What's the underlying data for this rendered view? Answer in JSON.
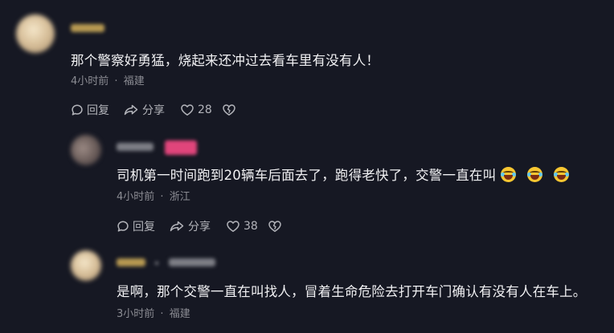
{
  "comments": [
    {
      "text": "那个警察好勇猛，烧起来还冲过去看车里有没有人！",
      "time": "4小时前",
      "dot": "·",
      "location": "福建",
      "reply_label": "回复",
      "share_label": "分享",
      "like_count": "28"
    },
    {
      "text": "司机第一时间跑到20辆车后面去了，跑得老快了，交警一直在叫",
      "time": "4小时前",
      "dot": "·",
      "location": "浙江",
      "reply_label": "回复",
      "share_label": "分享",
      "like_count": "38"
    },
    {
      "text": "是啊，那个交警一直在叫找人，冒着生命危险去打开车门确认有没有人在车上。",
      "time": "3小时前",
      "dot": "·",
      "location": "福建"
    }
  ],
  "icons": {
    "reply": "reply-bubble-icon",
    "share": "share-arrow-icon",
    "like": "heart-icon",
    "dislike": "broken-heart-icon",
    "emoji": "laughing-crying-emoji-icon"
  },
  "colors": {
    "background": "#161823",
    "text": "#f1f1f3",
    "meta": "#8b8c93",
    "badge": "#e0457b"
  }
}
